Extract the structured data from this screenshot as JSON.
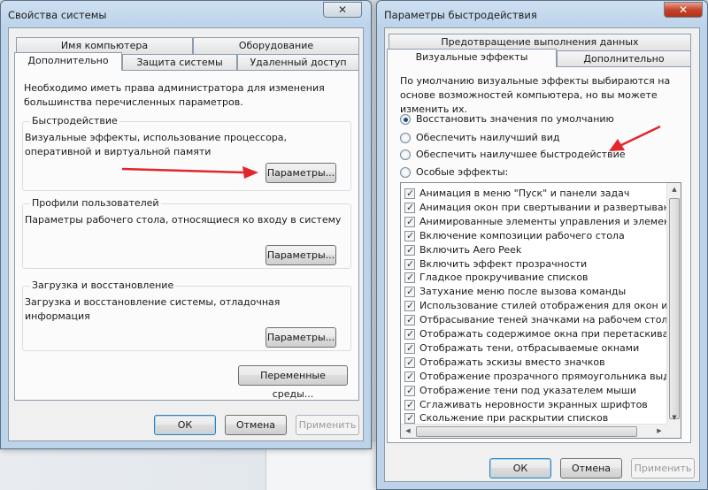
{
  "left_window": {
    "title": "Свойства системы",
    "close_glyph": "✕",
    "tabs_row1": [
      "Имя компьютера",
      "Оборудование"
    ],
    "tabs_row2": [
      "Дополнительно",
      "Защита системы",
      "Удаленный доступ"
    ],
    "admin_note": "Необходимо иметь права администратора для изменения большинства перечисленных параметров.",
    "performance": {
      "title": "Быстродействие",
      "description": "Визуальные эффекты, использование процессора, оперативной и виртуальной памяти",
      "button": "Параметры..."
    },
    "profiles": {
      "title": "Профили пользователей",
      "description": "Параметры рабочего стола, относящиеся ко входу в систему",
      "button": "Параметры..."
    },
    "startup": {
      "title": "Загрузка и восстановление",
      "description": "Загрузка и восстановление системы, отладочная информация",
      "button": "Параметры..."
    },
    "env_button": "Переменные среды...",
    "ok": "ОК",
    "cancel": "Отмена",
    "apply": "Применить"
  },
  "right_window": {
    "title": "Параметры быстродействия",
    "close_glyph": "✕",
    "tab_top": "Предотвращение выполнения данных",
    "tabs_row2": [
      "Визуальные эффекты",
      "Дополнительно"
    ],
    "intro": "По умолчанию визуальные эффекты выбираются на основе возможностей компьютера, но вы можете изменить их.",
    "radios": [
      {
        "label": "Восстановить значения по умолчанию",
        "checked": true
      },
      {
        "label": "Обеспечить наилучший вид",
        "checked": false
      },
      {
        "label": "Обеспечить наилучшее быстродействие",
        "checked": false
      },
      {
        "label": "Особые эффекты:",
        "checked": false
      }
    ],
    "effects": [
      "Анимация в меню \"Пуск\" и панели задач",
      "Анимация окон при свертывании и развертывании",
      "Анимированные элементы управления и элементы внутри",
      "Включение композиции рабочего стола",
      "Включить Aero Peek",
      "Включить эффект прозрачности",
      "Гладкое прокручивание списков",
      "Затухание меню после вызова команды",
      "Использование стилей отображения для окон и кнопок",
      "Отбрасывание теней значками на рабочем столе",
      "Отображать содержимое окна при перетаскивании",
      "Отображать тени, отбрасываемые окнами",
      "Отображать эскизы вместо значков",
      "Отображение прозрачного прямоугольника выделения",
      "Отображение тени под указателем мыши",
      "Сглаживать неровности экранных шрифтов",
      "Скольжение при раскрытии списков"
    ],
    "ok": "ОК",
    "cancel": "Отмена",
    "apply": "Применить"
  },
  "colors": {
    "arrow": "#e3262b",
    "selected_radio": "#1e4e7a"
  }
}
